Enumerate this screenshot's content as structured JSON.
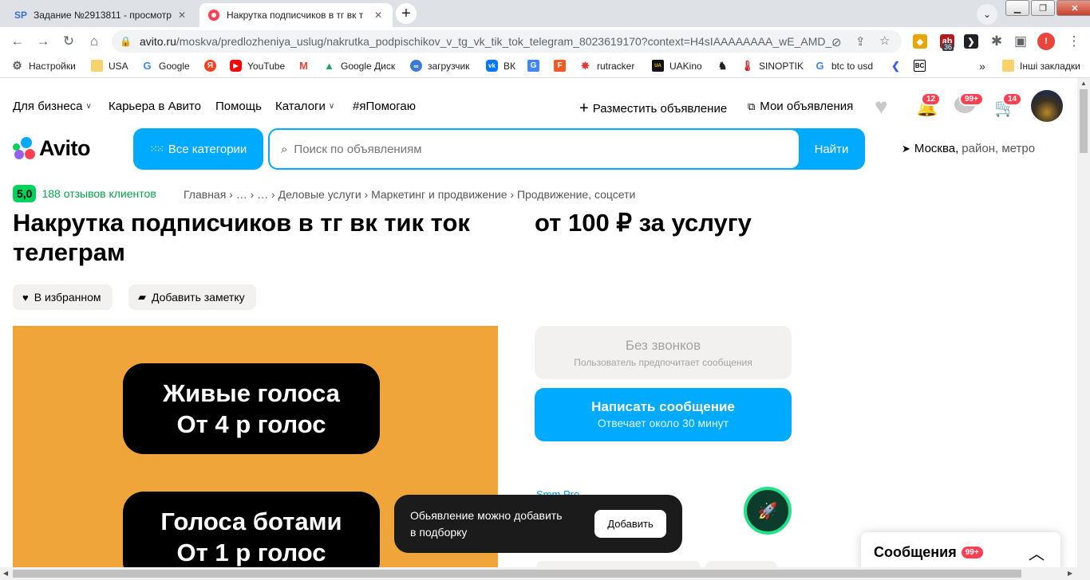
{
  "browser": {
    "tabs": [
      {
        "favicon": "SP",
        "title": "Задание №2913811 - просмотр",
        "active": false
      },
      {
        "favicon": "avito",
        "title": "Накрутка подписчиков в тг вк т",
        "active": true
      }
    ],
    "new_tab": "+",
    "address": {
      "host": "avito.ru",
      "path": "/moskva/predlozheniya_uslug/nakrutka_podpischikov_v_tg_vk_tik_tok_telegram_8023619170?context=H4sIAAAAAAAA_wE_AMD_..."
    },
    "extension_badge": "36",
    "bookmarks": [
      {
        "icon": "gear-icon",
        "label": "Настройки"
      },
      {
        "icon": "folder-icon",
        "label": "USA"
      },
      {
        "icon": "google-icon",
        "label": "Google"
      },
      {
        "icon": "yandex-icon",
        "label": ""
      },
      {
        "icon": "youtube-icon",
        "label": "YouTube"
      },
      {
        "icon": "gmail-icon",
        "label": ""
      },
      {
        "icon": "drive-icon",
        "label": "Google Диск"
      },
      {
        "icon": "loop-icon",
        "label": "загрузчик"
      },
      {
        "icon": "vk-icon",
        "label": "ВК"
      },
      {
        "icon": "translate-icon",
        "label": ""
      },
      {
        "icon": "f-icon",
        "label": ""
      },
      {
        "icon": "rutracker-icon",
        "label": "rutracker"
      },
      {
        "icon": "uakino-icon",
        "label": "UAKino"
      },
      {
        "icon": "chess-icon",
        "label": ""
      },
      {
        "icon": "thermometer-icon",
        "label": "SINOPTIK"
      },
      {
        "icon": "google-icon",
        "label": "btc to usd"
      },
      {
        "icon": "arrow-icon",
        "label": ""
      },
      {
        "icon": "bc-icon",
        "label": ""
      }
    ],
    "bookmarks_more": "»",
    "other_bookmarks": "Інші закладки"
  },
  "site": {
    "topnav": {
      "business": "Для бизнеса",
      "career": "Карьера в Авито",
      "help": "Помощь",
      "catalogs": "Каталоги",
      "hashtag": "#яПомогаю",
      "post_ad": "Разместить объявление",
      "my_ads": "Мои объявления",
      "notifications_count": "12",
      "messages_count": "99+",
      "cart_count": "14"
    },
    "logo_text": "Avito",
    "all_categories": "Все категории",
    "search": {
      "placeholder": "Поиск по объявлениям",
      "button": "Найти"
    },
    "location": {
      "city": "Москва,",
      "rest": "район, метро"
    }
  },
  "listing": {
    "rating": "5,0",
    "reviews": "188 отзывов клиентов",
    "breadcrumbs": "Главная › … › … › Деловые услуги › Маркетинг и продвижение › Продвижение, соцсети",
    "title": "Накрутка подписчиков в тг вк тик ток телеграм",
    "price": "от 100 ₽ за услугу",
    "favorite_label": "В избранном",
    "note_label": "Добавить заметку",
    "photo": {
      "block1": {
        "line1": "Живые голоса",
        "line2": "От 4 р голос"
      },
      "block2": {
        "line1": "Голоса ботами",
        "line2": "От 1 р голос"
      }
    },
    "no_calls": {
      "title": "Без звонков",
      "subtitle": "Пользователь предпочитает сообщения"
    },
    "write": {
      "title": "Написать сообщение",
      "subtitle": "Отвечает около 30 минут"
    },
    "seller_name": "Smm Pro"
  },
  "toast": {
    "text_line1": "Обьявление можно добавить",
    "text_line2": "в подборку",
    "button": "Добавить"
  },
  "messages_panel": {
    "title": "Сообщения",
    "count": "99+"
  },
  "colors": {
    "brand_blue": "#00aaff",
    "rating_green": "#02d15c",
    "badge_red": "#ff4053",
    "photo_orange": "#f0a53a"
  }
}
